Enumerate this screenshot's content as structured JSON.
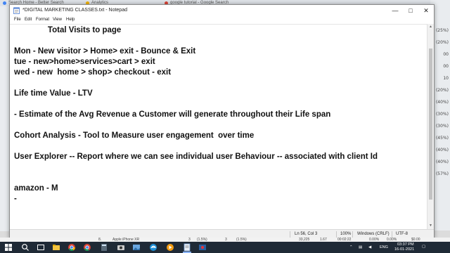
{
  "background": {
    "tabs": [
      {
        "label": "Search Home - Better Search",
        "color": "#4285f4"
      },
      {
        "label": "Analytics",
        "color": "#f4b400"
      },
      {
        "label": "google tutorial - Google Search",
        "color": "#db4437"
      }
    ],
    "right_values": [
      "(25%)",
      "(20%)",
      "00",
      "00",
      "10",
      "(20%)",
      "(40%)",
      "(30%)",
      "(30%)",
      "(45%)",
      "(40%)",
      "(40%)",
      "(57%)"
    ],
    "row": [
      "8.",
      "Apple iPhone XR",
      "3",
      "(1.5%)",
      "3",
      "(1.5%)",
      "33,225",
      "1.67",
      "00:02:22",
      "0.00%",
      "0.00%",
      "$0.00"
    ]
  },
  "notepad": {
    "title": "*DIGITAL MARKETING CLASSES.txt - Notepad",
    "menu": [
      "File",
      "Edit",
      "Format",
      "View",
      "Help"
    ],
    "lines": [
      "               Total Visits to page",
      "",
      "Mon - New visitor > Home> exit - Bounce & Exit",
      "tue - new>home>services>cart > exit",
      "wed - new  home > shop> checkout - exit",
      "",
      "Life time Value - LTV",
      "",
      "- Estimate of the Avg Revenue a Customer will generate throughout their Life span",
      "",
      "Cohort Analysis - Tool to Measure user engagement  over time",
      "",
      "User Explorer -- Report where we can see individual user Behaviour -- associated with client Id",
      "",
      "",
      "amazon - M",
      "-"
    ],
    "status": {
      "position": "Ln 56, Col 3",
      "zoom": "100%",
      "line_endings": "Windows (CRLF)",
      "encoding": "UTF-8"
    }
  },
  "taskbar": {
    "language": "ENG",
    "time": "03:37 PM",
    "date": "16-01-2021"
  }
}
